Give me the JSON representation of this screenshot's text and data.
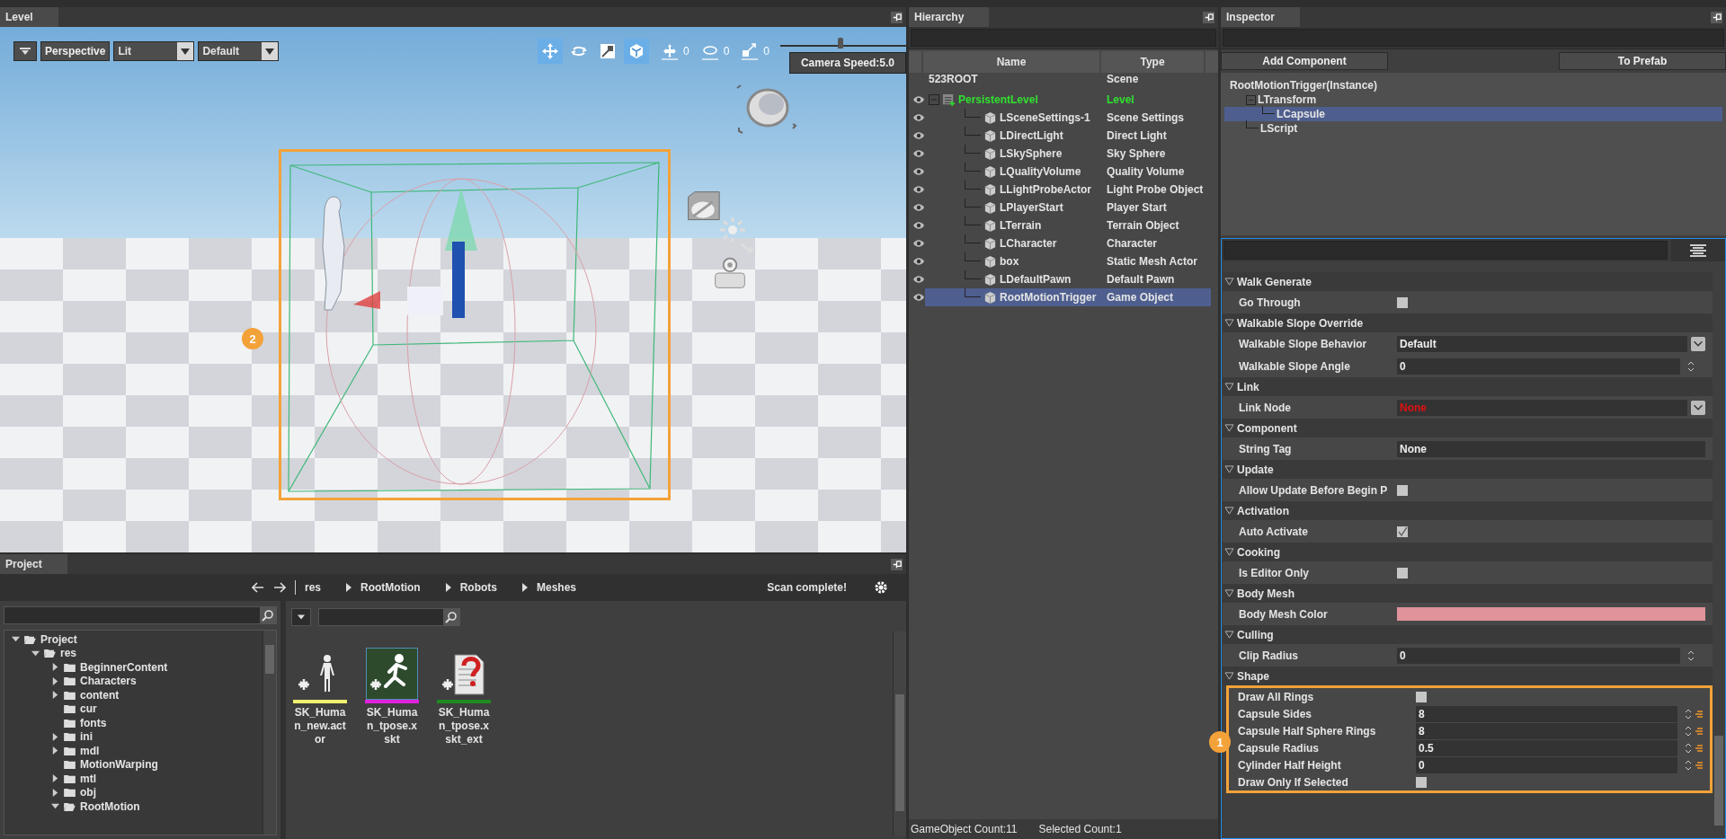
{
  "level": {
    "tab": "Level",
    "view_mode": "Perspective",
    "lighting": "Lit",
    "preset": "Default",
    "tools": [
      {
        "kind": "move",
        "selected": true
      },
      {
        "kind": "rotate",
        "selected": false
      },
      {
        "kind": "scale",
        "selected": false
      },
      {
        "kind": "local",
        "selected": true
      }
    ],
    "snaps": [
      {
        "kind": "move",
        "value": "0"
      },
      {
        "kind": "rotate",
        "value": "0"
      },
      {
        "kind": "scale",
        "value": "0"
      }
    ],
    "camera_speed": {
      "level": 0.48,
      "label": "Camera Speed:5.0"
    },
    "callout": "2"
  },
  "hierarchy": {
    "tab": "Hierarchy",
    "columns": [
      "Name",
      "Type"
    ],
    "tree": [
      {
        "name": "523ROOT",
        "type": "Scene",
        "kind": "scene",
        "selected": false,
        "children": [
          {
            "name": "PersistentLevel",
            "type": "Level",
            "kind": "level",
            "visible": true,
            "selected": false,
            "expanded": true,
            "children": [
              {
                "name": "LSceneSettings-1",
                "type": "Scene Settings",
                "kind": "object",
                "visible": true,
                "selected": false
              },
              {
                "name": "LDirectLight",
                "type": "Direct Light",
                "kind": "object",
                "visible": true,
                "selected": false
              },
              {
                "name": "LSkySphere",
                "type": "Sky Sphere",
                "kind": "object",
                "visible": true,
                "selected": false
              },
              {
                "name": "LQualityVolume",
                "type": "Quality Volume",
                "kind": "object",
                "visible": true,
                "selected": false
              },
              {
                "name": "LLightProbeActor",
                "type": "Light Probe Object",
                "kind": "object",
                "visible": true,
                "selected": false
              },
              {
                "name": "LPlayerStart",
                "type": "Player Start",
                "kind": "object",
                "visible": true,
                "selected": false
              },
              {
                "name": "LTerrain",
                "type": "Terrain Object",
                "kind": "object",
                "visible": true,
                "selected": false
              },
              {
                "name": "LCharacter",
                "type": "Character",
                "kind": "object",
                "visible": true,
                "selected": false
              },
              {
                "name": "box",
                "type": "Static Mesh Actor",
                "kind": "object",
                "visible": true,
                "selected": false
              },
              {
                "name": "LDefaultPawn",
                "type": "Default Pawn",
                "kind": "object",
                "visible": true,
                "selected": false
              },
              {
                "name": "RootMotionTrigger",
                "type": "Game Object",
                "kind": "object",
                "visible": true,
                "selected": true
              }
            ]
          }
        ]
      }
    ],
    "footer": [
      "GameObject Count:11",
      "Selected Count:1"
    ]
  },
  "inspector": {
    "tab": "Inspector",
    "buttons": [
      "Add Component",
      "To Prefab"
    ],
    "components": [
      {
        "name": "RootMotionTrigger(Instance)",
        "selected": false,
        "children": [
          {
            "name": "LTransform",
            "selected": false,
            "expanded": true,
            "children": [
              {
                "name": "LCapsule",
                "selected": true
              }
            ]
          },
          {
            "name": "LScript",
            "selected": false
          }
        ]
      }
    ],
    "groups": [
      {
        "title": "Walk Generate",
        "expanded": true,
        "props": [
          {
            "kind": "checkbox",
            "label": "Go Through",
            "checked": false
          }
        ]
      },
      {
        "title": "Walkable Slope Override",
        "expanded": true,
        "props": [
          {
            "kind": "dropdown",
            "label": "Walkable Slope Behavior",
            "value": "Default",
            "warning": false
          },
          {
            "kind": "number",
            "label": "Walkable Slope Angle",
            "value": "0",
            "keyframe": false
          }
        ]
      },
      {
        "title": "Link",
        "expanded": true,
        "props": [
          {
            "kind": "dropdown",
            "label": "Link Node",
            "value": "None",
            "warning": true
          }
        ]
      },
      {
        "title": "Component",
        "expanded": true,
        "props": [
          {
            "kind": "text",
            "label": "String Tag",
            "value": "None"
          }
        ]
      },
      {
        "title": "Update",
        "expanded": true,
        "props": [
          {
            "kind": "checkbox",
            "label": "Allow Update Before Begin P",
            "checked": false
          }
        ]
      },
      {
        "title": "Activation",
        "expanded": true,
        "props": [
          {
            "kind": "checkbox",
            "label": "Auto Activate",
            "checked": true
          }
        ]
      },
      {
        "title": "Cooking",
        "expanded": true,
        "props": [
          {
            "kind": "checkbox",
            "label": "Is Editor Only",
            "checked": false
          }
        ]
      },
      {
        "title": "Body Mesh",
        "expanded": true,
        "props": [
          {
            "kind": "color",
            "label": "Body Mesh Color",
            "color": "#e0939a"
          }
        ]
      },
      {
        "title": "Culling",
        "expanded": true,
        "props": [
          {
            "kind": "number",
            "label": "Clip Radius",
            "value": "0",
            "keyframe": false
          }
        ]
      },
      {
        "title": "Shape",
        "expanded": true,
        "callout": "1",
        "props": [
          {
            "kind": "checkbox",
            "label": "Draw All Rings",
            "checked": false
          },
          {
            "kind": "number",
            "label": "Capsule Sides",
            "value": "8",
            "keyframe": true
          },
          {
            "kind": "number",
            "label": "Capsule Half Sphere Rings",
            "value": "8",
            "keyframe": true
          },
          {
            "kind": "number",
            "label": "Capsule Radius",
            "value": "0.5",
            "keyframe": true
          },
          {
            "kind": "number",
            "label": "Cylinder Half Height",
            "value": "0",
            "keyframe": true
          },
          {
            "kind": "checkbox",
            "label": "Draw Only If Selected",
            "checked": false
          }
        ]
      }
    ]
  },
  "project": {
    "tab": "Project",
    "breadcrumb": [
      "res",
      "RootMotion",
      "Robots",
      "Meshes"
    ],
    "status": "Scan complete!",
    "folders": [
      {
        "name": "Project",
        "expandable": true,
        "expanded": true,
        "children": [
          {
            "name": "res",
            "expandable": true,
            "expanded": true,
            "children": [
              {
                "name": "BeginnerContent",
                "expandable": true,
                "expanded": false
              },
              {
                "name": "Characters",
                "expandable": true,
                "expanded": false
              },
              {
                "name": "content",
                "expandable": true,
                "expanded": false
              },
              {
                "name": "cur",
                "expandable": false,
                "expanded": false
              },
              {
                "name": "fonts",
                "expandable": false,
                "expanded": false
              },
              {
                "name": "ini",
                "expandable": true,
                "expanded": false
              },
              {
                "name": "mdl",
                "expandable": true,
                "expanded": false
              },
              {
                "name": "MotionWarping",
                "expandable": false,
                "expanded": false
              },
              {
                "name": "mtl",
                "expandable": true,
                "expanded": false
              },
              {
                "name": "obj",
                "expandable": true,
                "expanded": false
              },
              {
                "name": "RootMotion",
                "expandable": true,
                "expanded": true
              }
            ]
          }
        ]
      }
    ],
    "assets": [
      {
        "name": "SK_Human_new.actor",
        "kind": "actor",
        "color": "#f0f070",
        "selected": false
      },
      {
        "name": "SK_Human_tpose.xskt",
        "kind": "skeleton",
        "color": "#e020e0",
        "selected": true
      },
      {
        "name": "SK_Human_tpose.xskt_ext",
        "kind": "unknown",
        "color": "#208a20",
        "selected": false
      }
    ]
  }
}
